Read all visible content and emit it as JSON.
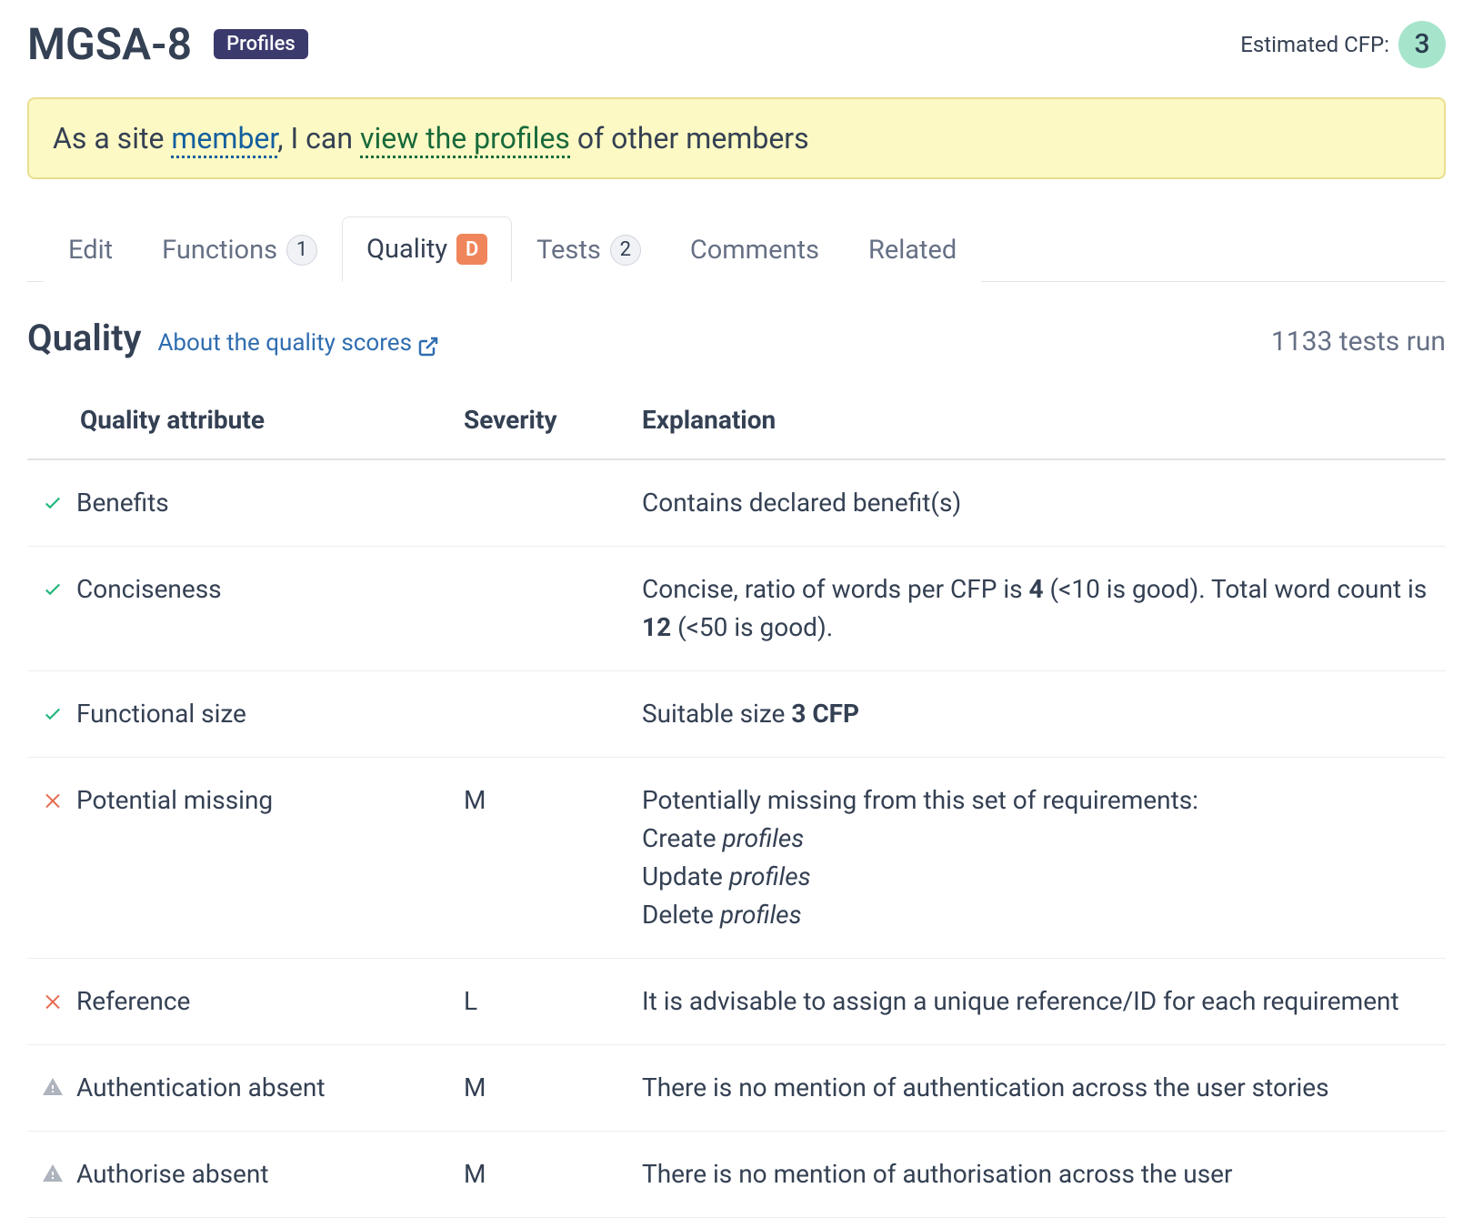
{
  "header": {
    "title": "MGSA-8",
    "tag": "Profiles",
    "cfp_label": "Estimated CFP:",
    "cfp_value": "3"
  },
  "story": {
    "prefix": "As a site ",
    "link1": "member",
    "mid": ", I can ",
    "link2": "view the profiles",
    "suffix": " of other members"
  },
  "tabs": [
    {
      "id": "edit",
      "label": "Edit"
    },
    {
      "id": "functions",
      "label": "Functions",
      "count": "1"
    },
    {
      "id": "quality",
      "label": "Quality",
      "grade": "D",
      "active": true
    },
    {
      "id": "tests",
      "label": "Tests",
      "count": "2"
    },
    {
      "id": "comments",
      "label": "Comments"
    },
    {
      "id": "related",
      "label": "Related"
    }
  ],
  "section": {
    "title": "Quality",
    "about_link": "About the quality scores",
    "tests_run": "1133 tests run"
  },
  "table": {
    "headers": {
      "attribute": "Quality attribute",
      "severity": "Severity",
      "explanation": "Explanation"
    },
    "rows": [
      {
        "icon": "check",
        "attribute": "Benefits",
        "severity": "",
        "explanation_html": "Contains declared benefit(s)"
      },
      {
        "icon": "check",
        "attribute": "Conciseness",
        "severity": "",
        "explanation_html": "Concise, ratio of words per CFP is <b>4</b> (<10 is good). Total word count is <b>12</b> (<50 is good)."
      },
      {
        "icon": "check",
        "attribute": "Functional size",
        "severity": "",
        "explanation_html": "Suitable size <b>3 CFP</b>"
      },
      {
        "icon": "cross",
        "attribute": "Potential missing",
        "severity": "M",
        "explanation_html": "Potentially missing from this set of requirements:<br>Create <span class=\"italic\">profiles</span><br>Update <span class=\"italic\">profiles</span><br>Delete <span class=\"italic\">profiles</span>"
      },
      {
        "icon": "cross",
        "attribute": "Reference",
        "severity": "L",
        "explanation_html": "It is advisable to assign a unique reference/ID for each requirement"
      },
      {
        "icon": "warn",
        "attribute": "Authentication absent",
        "severity": "M",
        "explanation_html": "There is no mention of authentication across the user stories"
      },
      {
        "icon": "warn",
        "attribute": "Authorise absent",
        "severity": "M",
        "explanation_html": "There is no mention of authorisation across the user"
      }
    ]
  }
}
